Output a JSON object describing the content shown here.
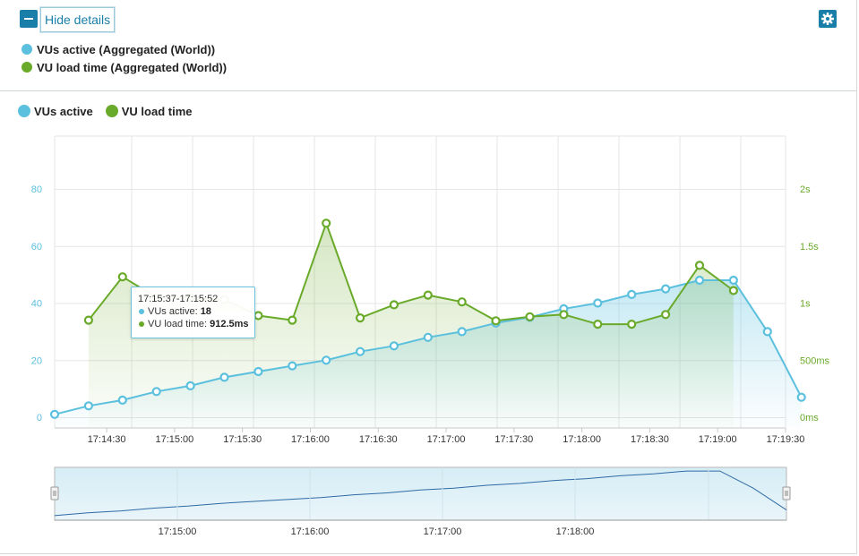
{
  "header": {
    "hide_details_label": "Hide details",
    "hide_icon": "minus-icon",
    "settings_icon": "gear-icon",
    "series_list": [
      {
        "label": "VUs active (Aggregated (World))",
        "color": "#5bc0de"
      },
      {
        "label": "VU load time (Aggregated (World))",
        "color": "#6aaa2a"
      }
    ]
  },
  "legend": [
    {
      "label": "VUs active",
      "color": "#5bc0de"
    },
    {
      "label": "VU load time",
      "color": "#6aaa2a"
    }
  ],
  "tooltip": {
    "header": "17:15:37-17:15:52",
    "rows": [
      {
        "label": "VUs active: ",
        "value": "18",
        "color": "#5bc0de"
      },
      {
        "label": "VU load time: ",
        "value": "912.5ms",
        "color": "#6aaa2a"
      }
    ]
  },
  "chart_data": {
    "type": "line",
    "grid": true,
    "legend_position": "top-left",
    "x_ticks": [
      "17:14:30",
      "17:15:00",
      "17:15:30",
      "17:16:00",
      "17:16:30",
      "17:17:00",
      "17:17:30",
      "17:18:00",
      "17:18:30",
      "17:19:00",
      "17:19:30"
    ],
    "x_range": [
      "17:14:07",
      "17:19:30"
    ],
    "y_left": {
      "ticks": [
        "0",
        "20",
        "40",
        "60",
        "80"
      ],
      "range": [
        0,
        80
      ],
      "color": "#5bc0de"
    },
    "y_right": {
      "ticks": [
        "0ms",
        "500ms",
        "1s",
        "1.5s",
        "2s"
      ],
      "range_ms": [
        0,
        2000
      ],
      "color": "#6aaa2a"
    },
    "series": [
      {
        "name": "VUs active",
        "axis": "left",
        "color": "#5bc0de",
        "x": [
          "17:14:07",
          "17:14:22",
          "17:14:37",
          "17:14:52",
          "17:15:07",
          "17:15:22",
          "17:15:37",
          "17:15:52",
          "17:16:07",
          "17:16:22",
          "17:16:37",
          "17:16:52",
          "17:17:07",
          "17:17:22",
          "17:17:37",
          "17:17:52",
          "17:18:07",
          "17:18:22",
          "17:18:37",
          "17:18:52",
          "17:19:07",
          "17:19:22",
          "17:19:37"
        ],
        "values": [
          1,
          4,
          6,
          9,
          11,
          14,
          16,
          18,
          20,
          23,
          25,
          28,
          30,
          33,
          35,
          38,
          40,
          43,
          45,
          48,
          48,
          30,
          7
        ]
      },
      {
        "name": "VU load time",
        "axis": "right",
        "color": "#6aaa2a",
        "x": [
          "17:14:22",
          "17:14:37",
          "17:14:52",
          "17:15:07",
          "17:15:22",
          "17:15:37",
          "17:15:52",
          "17:16:07",
          "17:16:22",
          "17:16:37",
          "17:16:52",
          "17:17:07",
          "17:17:22",
          "17:17:37",
          "17:17:52",
          "17:18:07",
          "17:18:22",
          "17:18:37",
          "17:18:52",
          "17:19:07"
        ],
        "values_ms": [
          850,
          1230,
          1050,
          1050,
          1030,
          890,
          850,
          1700,
          870,
          985,
          1070,
          1010,
          845,
          880,
          900,
          815,
          815,
          900,
          1330,
          1110
        ]
      }
    ]
  },
  "navigator": {
    "x_ticks": [
      "17:15:00",
      "17:16:00",
      "17:17:00",
      "17:18:00"
    ]
  }
}
